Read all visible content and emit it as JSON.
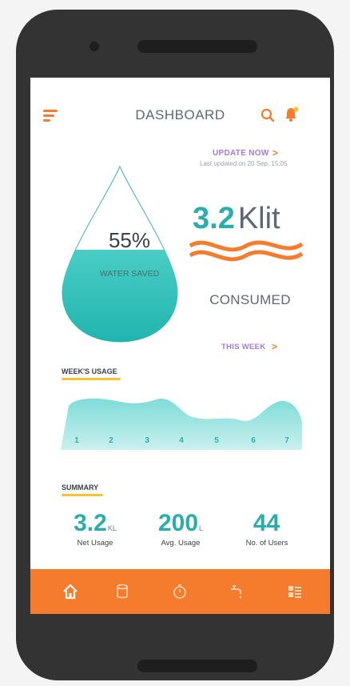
{
  "header": {
    "title": "DASHBOARD",
    "icons": [
      "hamburger-menu-icon",
      "search-icon",
      "bell-icon"
    ],
    "notification_dot_color": "#f6c234"
  },
  "update": {
    "label": "UPDATE NOW",
    "chevron": ">",
    "last_updated": "Last updated on 20 Sep, 15:05"
  },
  "water_drop": {
    "percent": "55%",
    "fill_fraction": 0.55,
    "label": "WATER SAVED"
  },
  "consumption": {
    "value": "3.2",
    "unit": "Klit",
    "label": "CONSUMED"
  },
  "period": {
    "label": "THIS WEEK",
    "chevron": ">"
  },
  "week_usage": {
    "title": "WEEK'S USAGE",
    "days": [
      "1",
      "2",
      "3",
      "4",
      "5",
      "6",
      "7"
    ]
  },
  "summary": {
    "title": "SUMMARY",
    "stats": [
      {
        "value": "3.2",
        "unit": "KL",
        "label": "Net Usage"
      },
      {
        "value": "200",
        "unit": "L",
        "label": "Avg. Usage"
      },
      {
        "value": "44",
        "unit": "",
        "label": "No. of Users"
      }
    ]
  },
  "bottom_nav": {
    "items": [
      "home-icon",
      "tank-icon",
      "timer-icon",
      "tap-icon",
      "list-icon"
    ],
    "active": "home-icon"
  },
  "colors": {
    "accent_orange": "#f47c2c",
    "teal": "#2aaeac",
    "purple_link": "#a07bd7",
    "yellow_underline": "#f6c234"
  }
}
